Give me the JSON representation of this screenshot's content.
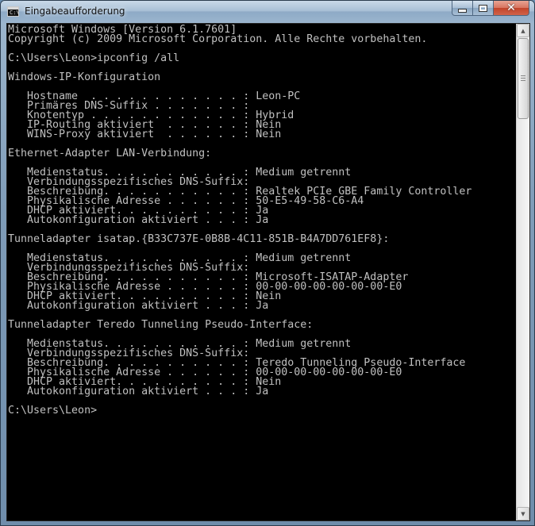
{
  "window": {
    "title": "Eingabeaufforderung",
    "app_icon": "cmd-icon",
    "controls": [
      "minimize-icon",
      "maximize-icon",
      "close-icon"
    ]
  },
  "console": {
    "lines": [
      "Microsoft Windows [Version 6.1.7601]",
      "Copyright (c) 2009 Microsoft Corporation. Alle Rechte vorbehalten.",
      "",
      "C:\\Users\\Leon>ipconfig /all",
      "",
      "Windows-IP-Konfiguration",
      "",
      "   Hostname  . . . . . . . . . . . . : Leon-PC",
      "   Primäres DNS-Suffix . . . . . . . :",
      "   Knotentyp . . . . . . . . . . . . : Hybrid",
      "   IP-Routing aktiviert  . . . . . . : Nein",
      "   WINS-Proxy aktiviert  . . . . . . : Nein",
      "",
      "Ethernet-Adapter LAN-Verbindung:",
      "",
      "   Medienstatus. . . . . . . . . . . : Medium getrennt",
      "   Verbindungsspezifisches DNS-Suffix:",
      "   Beschreibung. . . . . . . . . . . : Realtek PCIe GBE Family Controller",
      "   Physikalische Adresse . . . . . . : 50-E5-49-58-C6-A4",
      "   DHCP aktiviert. . . . . . . . . . : Ja",
      "   Autokonfiguration aktiviert . . . : Ja",
      "",
      "Tunneladapter isatap.{B33C737E-0B8B-4C11-851B-B4A7DD761EF8}:",
      "",
      "   Medienstatus. . . . . . . . . . . : Medium getrennt",
      "   Verbindungsspezifisches DNS-Suffix:",
      "   Beschreibung. . . . . . . . . . . : Microsoft-ISATAP-Adapter",
      "   Physikalische Adresse . . . . . . : 00-00-00-00-00-00-00-E0",
      "   DHCP aktiviert. . . . . . . . . . : Nein",
      "   Autokonfiguration aktiviert . . . : Ja",
      "",
      "Tunneladapter Teredo Tunneling Pseudo-Interface:",
      "",
      "   Medienstatus. . . . . . . . . . . : Medium getrennt",
      "   Verbindungsspezifisches DNS-Suffix:",
      "   Beschreibung. . . . . . . . . . . : Teredo Tunneling Pseudo-Interface",
      "   Physikalische Adresse . . . . . . : 00-00-00-00-00-00-00-E0",
      "   DHCP aktiviert. . . . . . . . . . : Nein",
      "   Autokonfiguration aktiviert . . . : Ja",
      "",
      "C:\\Users\\Leon>"
    ],
    "text_color": "#c0c0c0",
    "background_color": "#000000"
  },
  "scrollbar": {
    "up_icon": "scroll-up-arrow-icon",
    "down_icon": "scroll-down-arrow-icon"
  }
}
